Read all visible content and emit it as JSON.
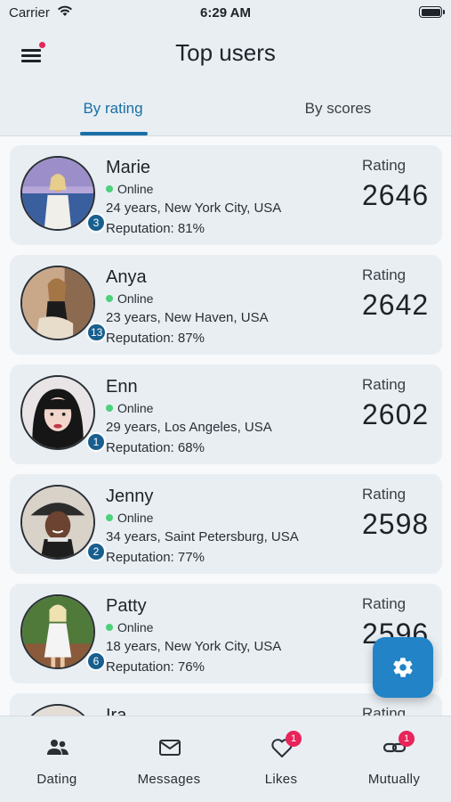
{
  "status_bar": {
    "carrier": "Carrier",
    "time": "6:29 AM"
  },
  "header": {
    "title": "Top users"
  },
  "tabs": [
    {
      "label": "By rating",
      "active": true
    },
    {
      "label": "By scores",
      "active": false
    }
  ],
  "users": [
    {
      "name": "Marie",
      "status": "Online",
      "details": "24 years, New York City, USA",
      "reputation": "Reputation: 81%",
      "rating_label": "Rating",
      "rating": "2646",
      "rank": "3"
    },
    {
      "name": "Anya",
      "status": "Online",
      "details": "23 years, New Haven, USA",
      "reputation": "Reputation: 87%",
      "rating_label": "Rating",
      "rating": "2642",
      "rank": "13"
    },
    {
      "name": "Enn",
      "status": "Online",
      "details": "29 years, Los Angeles, USA",
      "reputation": "Reputation: 68%",
      "rating_label": "Rating",
      "rating": "2602",
      "rank": "1"
    },
    {
      "name": "Jenny",
      "status": "Online",
      "details": "34 years, Saint Petersburg, USA",
      "reputation": "Reputation: 77%",
      "rating_label": "Rating",
      "rating": "2598",
      "rank": "2"
    },
    {
      "name": "Patty",
      "status": "Online",
      "details": "18 years, New York City, USA",
      "reputation": "Reputation: 76%",
      "rating_label": "Rating",
      "rating": "2596",
      "rank": "6"
    },
    {
      "name": "Ira",
      "status": "",
      "details": "",
      "reputation": "",
      "rating_label": "Rating",
      "rating": "",
      "rank": ""
    }
  ],
  "bottom_nav": [
    {
      "label": "Dating",
      "icon": "people-icon",
      "badge": ""
    },
    {
      "label": "Messages",
      "icon": "mail-icon",
      "badge": ""
    },
    {
      "label": "Likes",
      "icon": "heart-icon",
      "badge": "1"
    },
    {
      "label": "Mutually",
      "icon": "link-icon",
      "badge": "1"
    }
  ],
  "colors": {
    "accent": "#1a6fa6",
    "fab": "#2283c6",
    "online": "#4bd17a",
    "badge": "#e8245b",
    "rank_badge": "#185f8f"
  },
  "fab": {
    "icon": "gear-icon"
  }
}
